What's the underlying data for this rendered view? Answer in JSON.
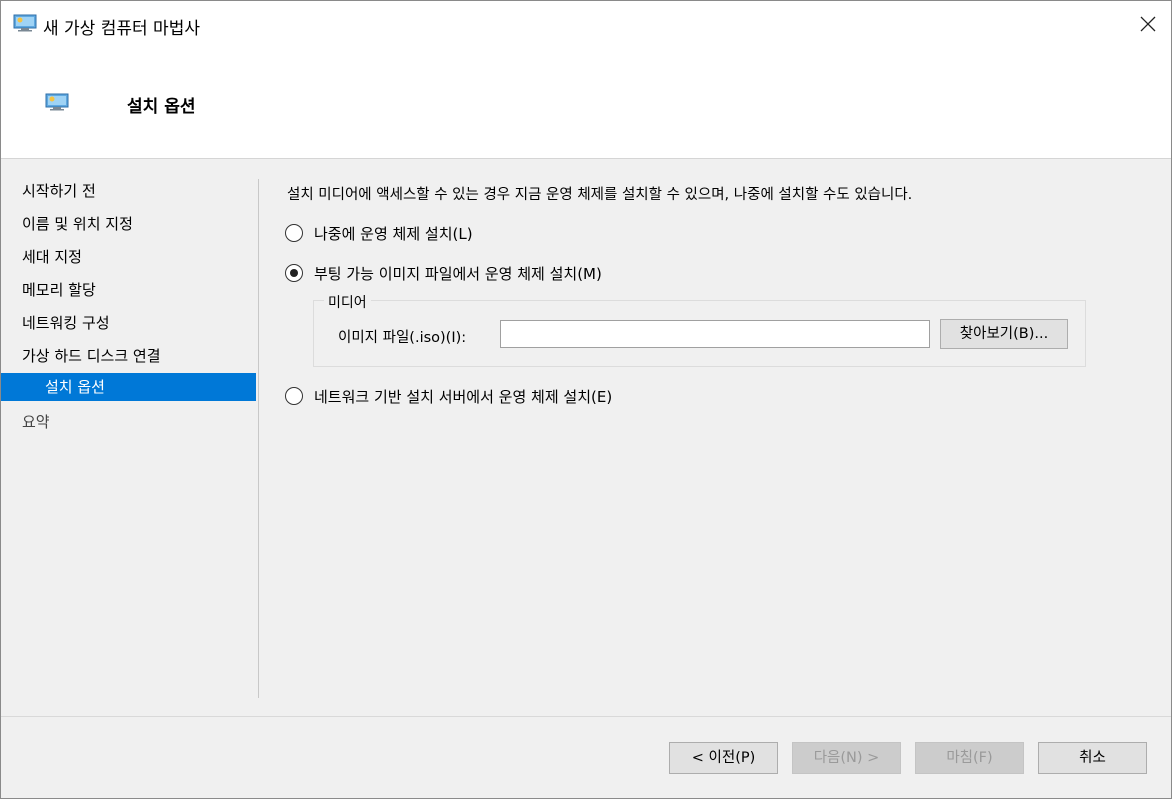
{
  "window": {
    "title": "새 가상 컴퓨터 마법사",
    "icon": "virtual-machine-icon",
    "close_icon": "close-icon"
  },
  "header": {
    "title": "설치 옵션",
    "icon": "virtual-machine-icon"
  },
  "nav": {
    "items": [
      {
        "label": "시작하기 전",
        "selected": false
      },
      {
        "label": "이름 및 위치 지정",
        "selected": false
      },
      {
        "label": "세대 지정",
        "selected": false
      },
      {
        "label": "메모리 할당",
        "selected": false
      },
      {
        "label": "네트워킹 구성",
        "selected": false
      },
      {
        "label": "가상 하드 디스크 연결",
        "selected": false
      },
      {
        "label": "설치 옵션",
        "selected": true
      },
      {
        "label": "요약",
        "selected": false
      }
    ]
  },
  "content": {
    "intro": "설치 미디어에 액세스할 수 있는 경우 지금 운영 체제를 설치할 수 있으며, 나중에 설치할 수도 있습니다.",
    "options": [
      {
        "label": "나중에 운영 체제 설치(L)",
        "checked": false
      },
      {
        "label": "부팅 가능 이미지 파일에서 운영 체제 설치(M)",
        "checked": true
      },
      {
        "label": "네트워크 기반 설치 서버에서 운영 체제 설치(E)",
        "checked": false
      }
    ],
    "media_group": {
      "legend": "미디어",
      "file_label": "이미지 파일(.iso)(I):",
      "file_value": "",
      "browse_label": "찾아보기(B)..."
    }
  },
  "footer": {
    "prev_label": "< 이전(P)",
    "next_label": "다음(N) >",
    "finish_label": "마침(F)",
    "cancel_label": "취소",
    "next_enabled": false,
    "finish_enabled": false
  },
  "colors": {
    "selection": "#0078d7",
    "body_bg": "#f0f0f0",
    "button_bg": "#e1e1e1"
  }
}
